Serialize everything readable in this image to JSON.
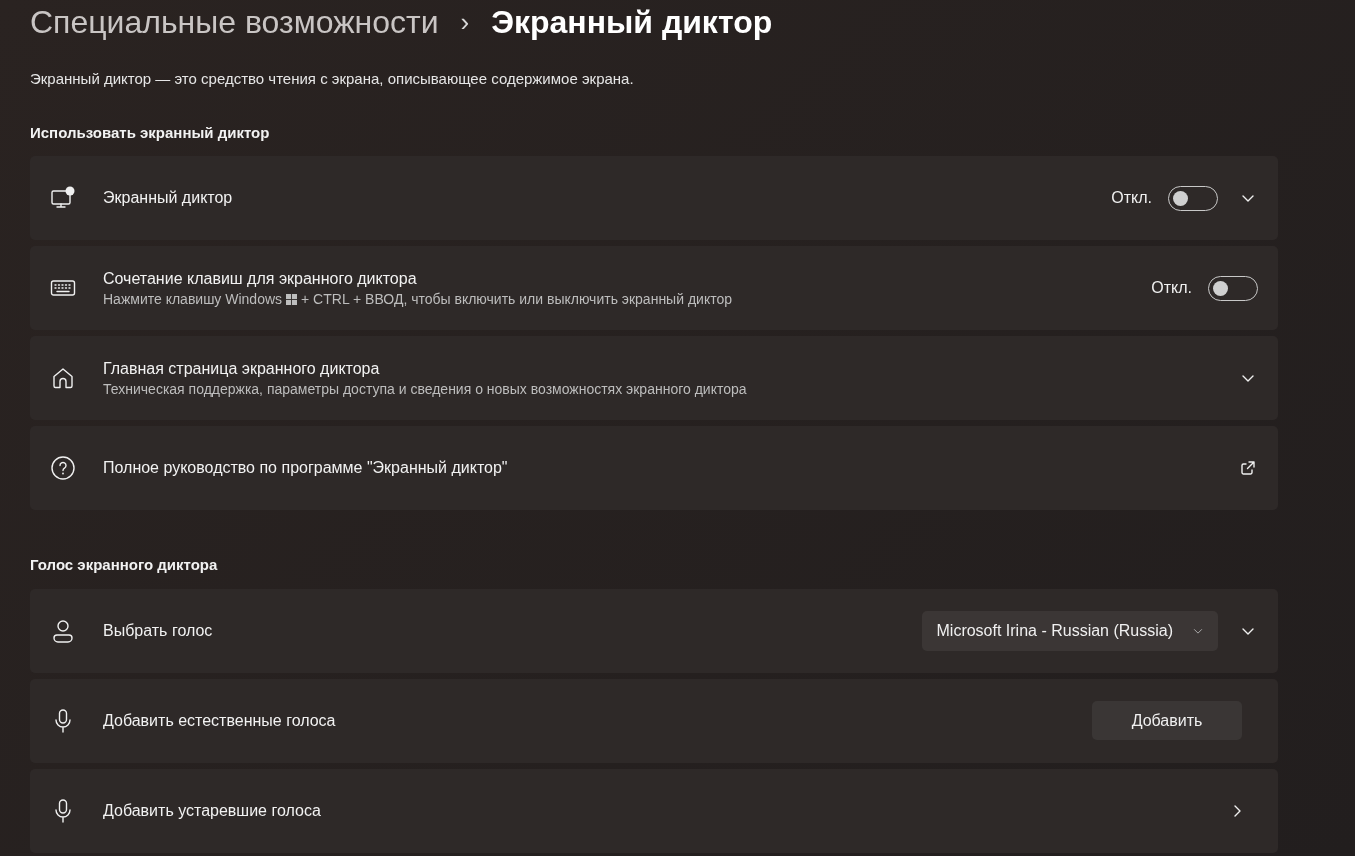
{
  "breadcrumb": {
    "parent": "Специальные возможности",
    "separator": "›",
    "current": "Экранный диктор"
  },
  "description": "Экранный диктор — это средство чтения с экрана, описывающее содержимое экрана.",
  "sections": [
    {
      "title": "Использовать экранный диктор",
      "rows": [
        {
          "kind": "toggle",
          "title": "Экранный диктор",
          "state_label": "Откл.",
          "on": false,
          "expanded": false
        },
        {
          "kind": "toggle",
          "title": "Сочетание клавиш для экранного диктора",
          "subtitle_before": "Нажмите клавишу Windows",
          "subtitle_after": "+ CTRL + ВВОД, чтобы включить или выключить экранный диктор",
          "state_label": "Откл.",
          "on": false
        },
        {
          "kind": "expand",
          "title": "Главная страница экранного диктора",
          "subtitle_before": "Техническая поддержка, параметры доступа и сведения о новых возможностях экранного диктора",
          "expanded": false
        },
        {
          "kind": "link",
          "title": "Полное руководство по программе \"Экранный диктор\""
        }
      ]
    },
    {
      "title": "Голос экранного диктора",
      "rows": [
        {
          "kind": "dropdown",
          "title": "Выбрать голос",
          "value": "Microsoft Irina - Russian (Russia)",
          "expanded": false
        },
        {
          "kind": "button",
          "title": "Добавить естественные голоса",
          "button": "Добавить"
        },
        {
          "kind": "nav",
          "title": "Добавить устаревшие голоса"
        }
      ]
    }
  ]
}
